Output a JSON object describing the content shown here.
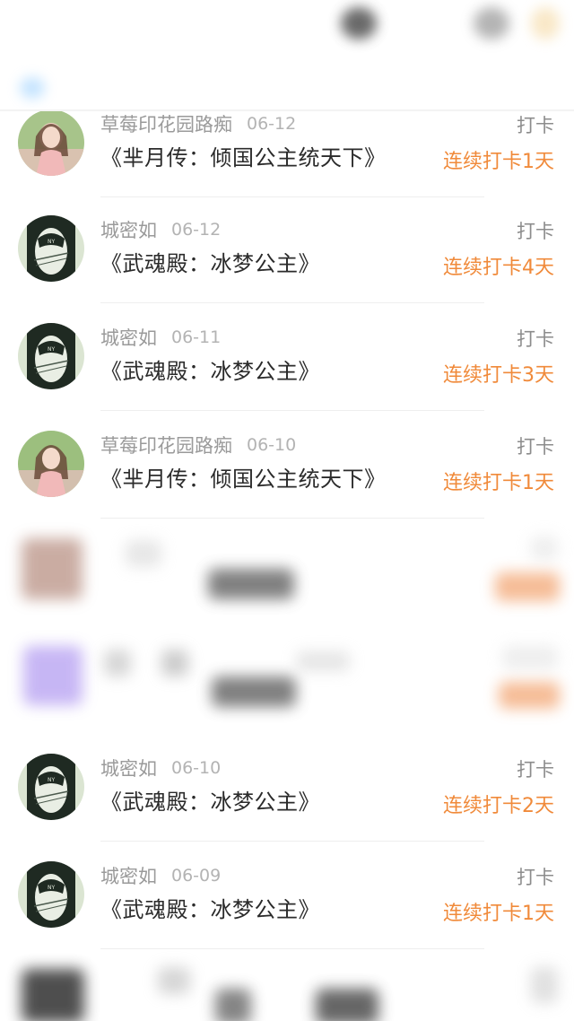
{
  "colors": {
    "streak": "#f08a3a",
    "name": "#9a9a9a",
    "title": "#2b2b2b"
  },
  "rows": [
    {
      "name": "草莓印花园路痴",
      "date": "06-12",
      "type": "打卡",
      "title": "《芈月传：倾国公主统天下》",
      "streak": "连续打卡1天",
      "avatar": "girl-pink-dress"
    },
    {
      "name": "城密如",
      "date": "06-12",
      "type": "打卡",
      "title": "《武魂殿：冰梦公主》",
      "streak": "连续打卡4天",
      "avatar": "green-sketch"
    },
    {
      "name": "城密如",
      "date": "06-11",
      "type": "打卡",
      "title": "《武魂殿：冰梦公主》",
      "streak": "连续打卡3天",
      "avatar": "green-sketch"
    },
    {
      "name": "草莓印花园路痴",
      "date": "06-10",
      "type": "打卡",
      "title": "《芈月传：倾国公主统天下》",
      "streak": "连续打卡1天",
      "avatar": "girl-pink-dress"
    },
    {
      "name": "城密如",
      "date": "06-10",
      "type": "打卡",
      "title": "《武魂殿：冰梦公主》",
      "streak": "连续打卡2天",
      "avatar": "green-sketch"
    },
    {
      "name": "城密如",
      "date": "06-09",
      "type": "打卡",
      "title": "《武魂殿：冰梦公主》",
      "streak": "连续打卡1天",
      "avatar": "green-sketch"
    }
  ]
}
